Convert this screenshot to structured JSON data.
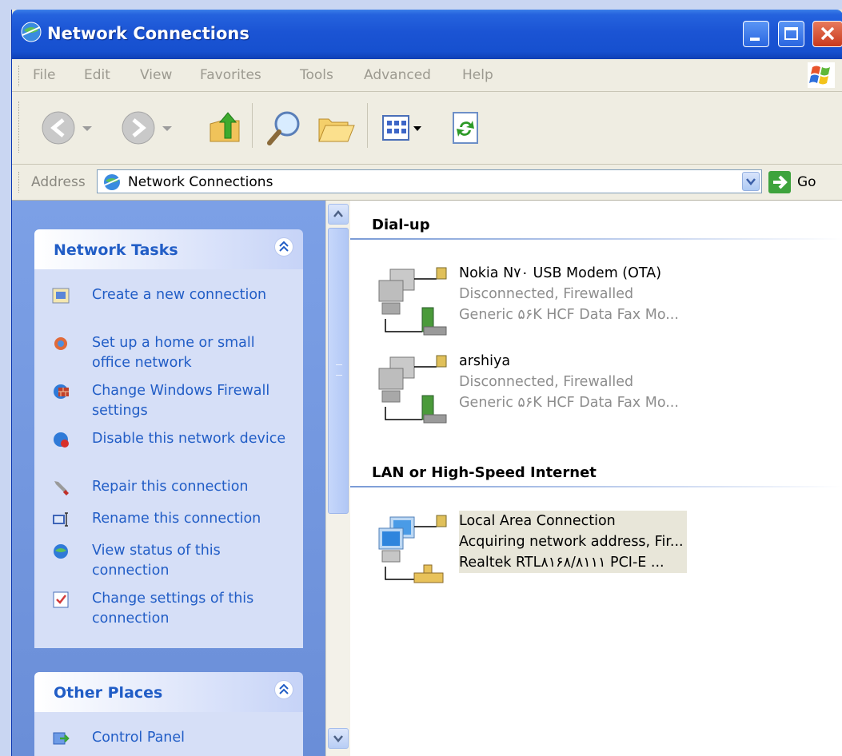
{
  "window": {
    "title": "Network Connections",
    "colors": {
      "titlebar": "#1650cf",
      "close": "#c8391c",
      "task_text": "#215dc6"
    }
  },
  "menu": {
    "items": [
      "File",
      "Edit",
      "View",
      "Favorites",
      "Tools",
      "Advanced",
      "Help"
    ]
  },
  "toolbar": {
    "buttons": [
      "back-icon",
      "forward-icon",
      "up-folder-icon",
      "search-icon",
      "folders-icon",
      "views-icon",
      "refresh-icon"
    ]
  },
  "address": {
    "label": "Address",
    "value": "Network Connections",
    "go_label": "Go"
  },
  "network_tasks": {
    "title": "Network Tasks",
    "items": [
      {
        "label": "Create a new connection",
        "icon": "new-connection-icon"
      },
      {
        "label": "Set up a home or small office network",
        "icon": "home-network-icon"
      },
      {
        "label": "Change Windows Firewall settings",
        "icon": "firewall-icon"
      },
      {
        "label": "Disable this network device",
        "icon": "disable-network-icon"
      },
      {
        "label": "Repair this connection",
        "icon": "repair-icon"
      },
      {
        "label": "Rename this connection",
        "icon": "rename-icon"
      },
      {
        "label": "View status of this connection",
        "icon": "status-icon"
      },
      {
        "label": "Change settings of this connection",
        "icon": "settings-icon"
      }
    ]
  },
  "other_places": {
    "title": "Other Places",
    "items": [
      {
        "label": "Control Panel",
        "icon": "control-panel-icon"
      }
    ]
  },
  "groups": [
    {
      "title": "Dial-up",
      "connections": [
        {
          "name": "Nokia N۷۰ USB Modem (OTA)",
          "status": "Disconnected, Firewalled",
          "device": "Generic ۵۶K HCF Data Fax Mo..."
        },
        {
          "name": "arshiya",
          "status": "Disconnected, Firewalled",
          "device": "Generic ۵۶K HCF Data Fax Mo..."
        }
      ]
    },
    {
      "title": "LAN or High-Speed Internet",
      "connections": [
        {
          "name": "Local Area Connection",
          "status": "Acquiring network address, Fir...",
          "device": "Realtek RTL۸۱۶۸/۸۱۱۱ PCI-E ...",
          "selected": true
        }
      ]
    }
  ]
}
